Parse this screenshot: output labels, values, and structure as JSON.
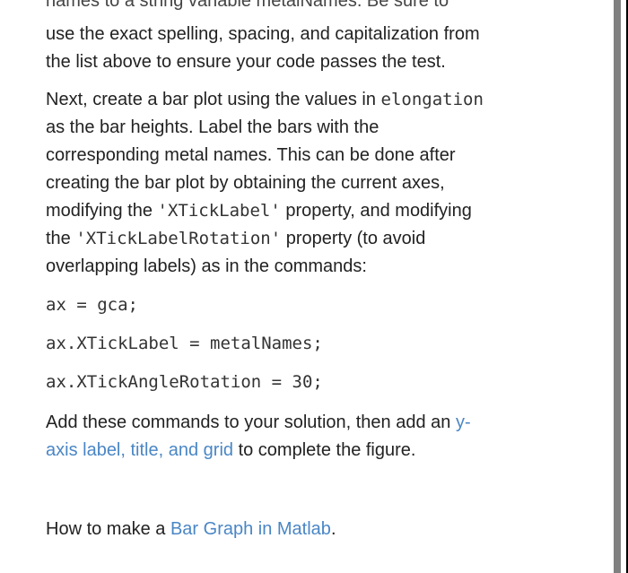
{
  "paragraphs": {
    "cut_line": "names to a string variable metalNames. Be sure to",
    "p1": {
      "line1": "use the exact spelling, spacing, and capitalization from",
      "line2": "the list above to ensure your code passes the test."
    },
    "p2": {
      "line1_a": "Next, create a bar plot using the values in ",
      "line1_code": "elongation",
      "line2": "as the bar heights. Label the bars with the",
      "line3": "corresponding metal names. This can be done after",
      "line4": "creating the bar plot by obtaining the current axes,",
      "line5_a": "modifying the ",
      "line5_code": "'XTickLabel'",
      "line5_b": " property, and modifying",
      "line6_a": "the ",
      "line6_code": "'XTickLabelRotation'",
      "line6_b": " property (to avoid",
      "line7": "overlapping labels) as in the commands:"
    },
    "code_lines": [
      "ax = gca;",
      "ax.XTickLabel = metalNames;",
      "ax.XTickAngleRotation = 30;"
    ],
    "p3": {
      "line1_a": "Add these commands to your solution, then add an ",
      "line1_link": "y-",
      "line2_link": "axis label, title, and grid",
      "line2_b": " to complete the figure."
    },
    "p4": {
      "text_a": "How to make a ",
      "link": "Bar Graph in Matlab",
      "text_b": "."
    }
  },
  "colors": {
    "link": "#4a86c5",
    "text": "#222222"
  }
}
